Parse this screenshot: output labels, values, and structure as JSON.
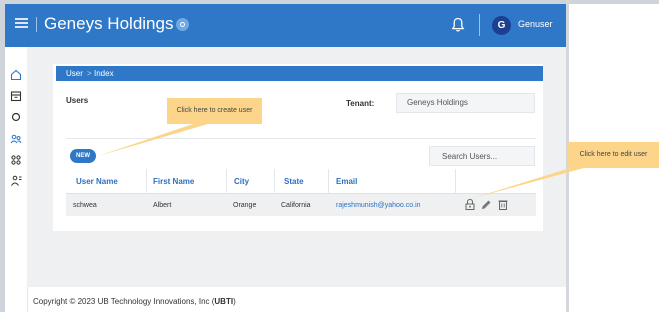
{
  "header": {
    "app_title": "Geneys Holdings",
    "user_initial": "G",
    "username": "Genuser"
  },
  "sidebar": {
    "items": [
      {
        "icon": "home-icon"
      },
      {
        "icon": "box-icon"
      },
      {
        "icon": "location-icon"
      },
      {
        "icon": "users-icon"
      },
      {
        "icon": "grid-icon"
      },
      {
        "icon": "person-settings-icon"
      }
    ]
  },
  "breadcrumb": {
    "root": "User",
    "separator": ">",
    "current": "Index"
  },
  "users_section": {
    "label": "Users",
    "tenant_label": "Tenant:",
    "tenant_value": "Geneys Holdings",
    "new_button": "NEW",
    "search_placeholder": "Search Users..."
  },
  "table": {
    "columns": [
      "User Name",
      "First Name",
      "City",
      "State",
      "Email"
    ],
    "rows": [
      {
        "user_name": "schwea",
        "first_name": "Albert",
        "city": "Orange",
        "state": "California",
        "email": "rajeshmunish@yahoo.co.in"
      }
    ]
  },
  "tooltips": {
    "create": "Click here to create user",
    "edit": "Click here to edit user"
  },
  "footer": {
    "prefix": "Copyright © 2023 UB Technology Innovations, Inc (",
    "bold": "UBTI",
    "suffix": ")"
  },
  "colors": {
    "brand_blue": "#2f78c8",
    "tooltip": "#fdd58a",
    "link": "#2f6fbf"
  }
}
